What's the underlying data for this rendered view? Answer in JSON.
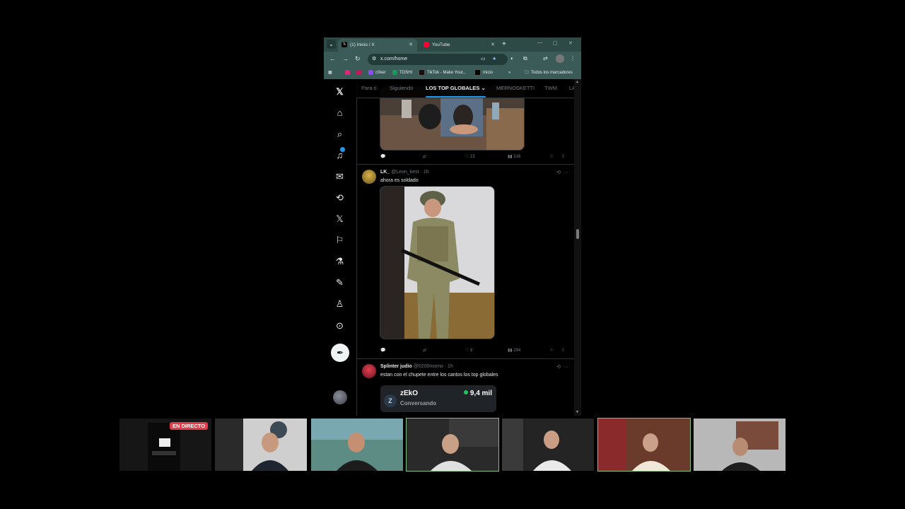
{
  "browser": {
    "tabs": [
      {
        "title": "(1) Inicio / X",
        "favicon": "x-icon",
        "active": true
      },
      {
        "title": "YouTube",
        "favicon": "youtube-icon",
        "active": false
      }
    ],
    "url": "x.com/home",
    "bookmarks": [
      "c0ker",
      "TOSHI",
      "TikTok - Make Your...",
      "Inicio"
    ],
    "all_bookmarks_label": "Todos los marcadores",
    "more_bookmarks": "»"
  },
  "x": {
    "timeline_tabs": [
      "Para ti",
      "Siguiendo",
      "LOS TOP GLOBALES",
      "MERNOSKETTI",
      "TWM",
      "LA"
    ],
    "active_tab_index": 2,
    "posts": [
      {
        "likes": "15",
        "views": "316"
      },
      {
        "name": "LK_",
        "handle": "@Leon_kest",
        "time": "· 1h",
        "text": "ahora es soldado",
        "likes": "9",
        "views": "294"
      },
      {
        "name": "Splinter judio",
        "handle": "@0200momo",
        "time": "· 1h",
        "text": "estan con el chupete entre los cantos los top globales"
      }
    ],
    "card": {
      "name": "zEkO",
      "status": "Conversando",
      "count": "9,4 mil",
      "live_color": "#22c55e"
    }
  },
  "stream": {
    "live_label": "EN DIRECTO",
    "accent": "#e23b4a"
  }
}
